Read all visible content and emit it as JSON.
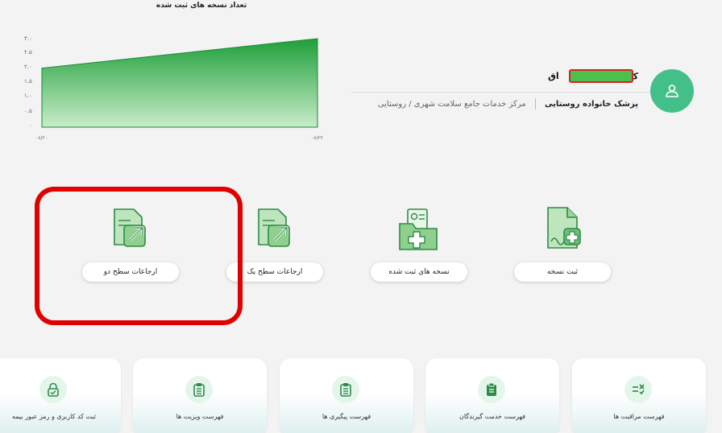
{
  "chart_data": {
    "type": "area",
    "title": "تعداد نسخه های ثبت شده",
    "x": [
      "۰۸/۲۰",
      "۰۸/۲۲"
    ],
    "values": [
      2.0,
      3.0
    ],
    "yticks": [
      "۳.۰",
      "۲.۵",
      "۲.۰",
      "۱.۵",
      "۱.۰",
      "۰.۵",
      "۰"
    ],
    "ylim": [
      0,
      3
    ],
    "colors": [
      "#1f9f3b",
      "#c8ecc9"
    ],
    "grid": false
  },
  "profile": {
    "name_start": "ک",
    "name_end": "اق",
    "role": "پزشک خانواده روستایی",
    "center": "مرکز خدمات جامع سلامت شهری / روستایی"
  },
  "actions": [
    {
      "label": "ثبت نسخه",
      "icon": "prescription-file-icon"
    },
    {
      "label": "نسخه های ثبت شده",
      "icon": "medical-folder-icon"
    },
    {
      "label": "ارجاعات سطح یک",
      "icon": "referral-level-one-icon"
    },
    {
      "label": "ارجاعات سطح دو",
      "icon": "referral-level-two-icon"
    }
  ],
  "cards": [
    {
      "label": "فهرست مراقبت ها",
      "icon": "checklist-icon"
    },
    {
      "label": "فهرست خدمت گیرندگان",
      "icon": "clipboard-icon"
    },
    {
      "label": "فهرست پیگیری ها",
      "icon": "clipboard-list-icon"
    },
    {
      "label": "فهرست ویزیت ها",
      "icon": "clipboard-list-icon"
    },
    {
      "label": "ثبت کد کاربری و رمز عبور بیمه",
      "icon": "lock-check-icon"
    }
  ]
}
